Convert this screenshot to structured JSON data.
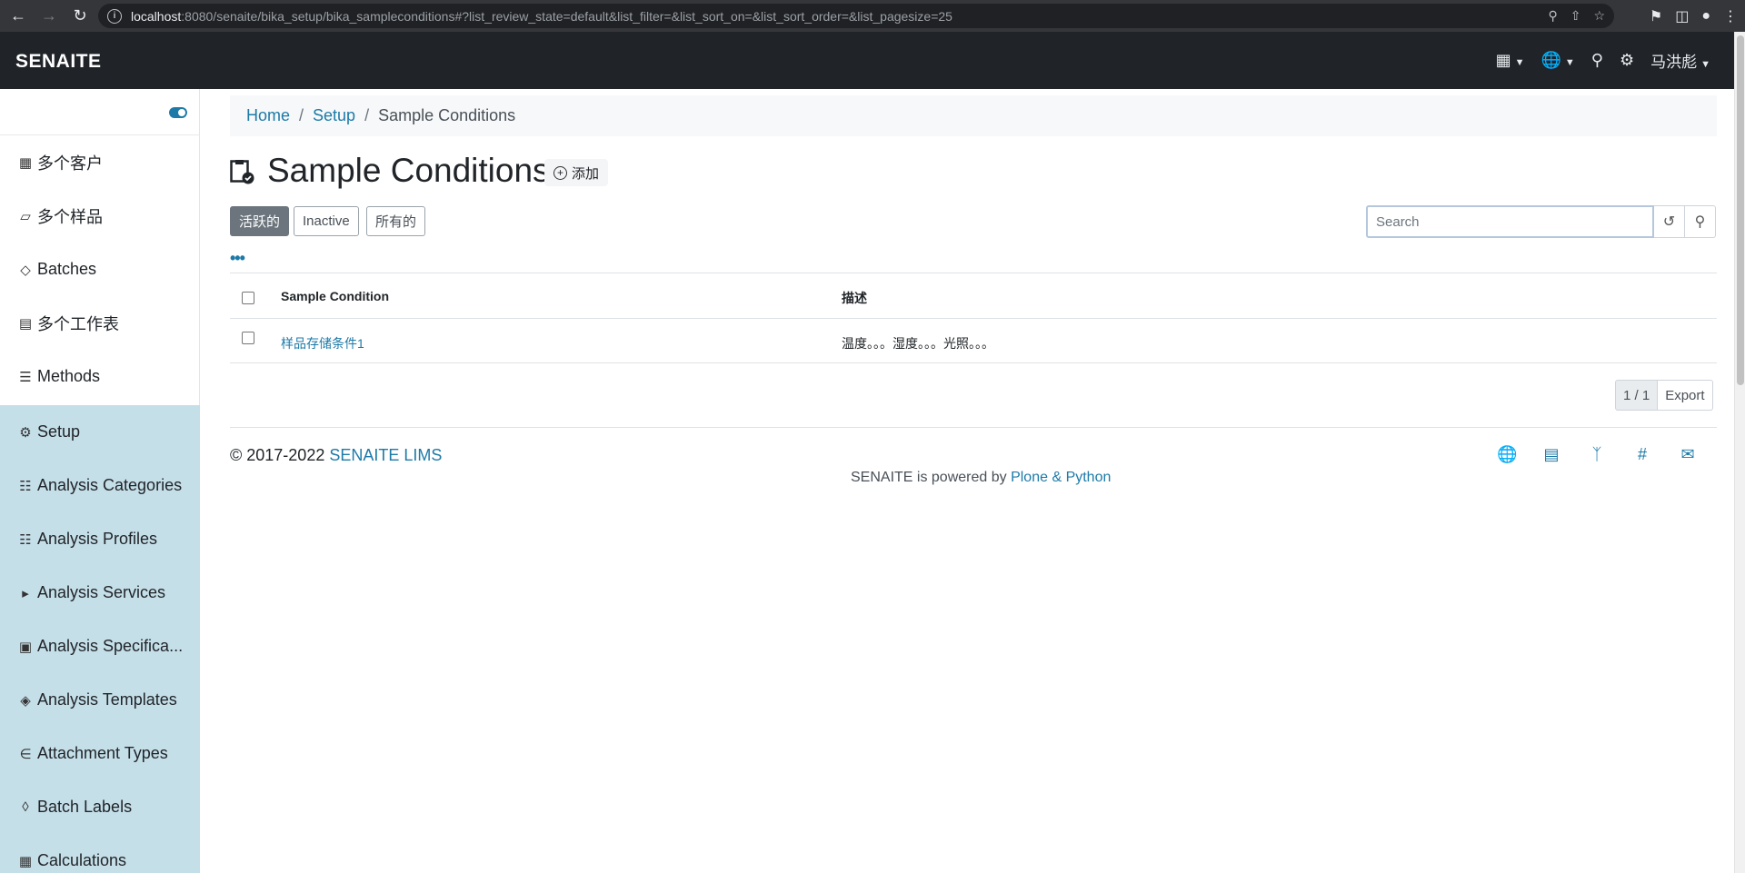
{
  "browser": {
    "url_host": "localhost",
    "url_rest": ":8080/senaite/bika_setup/bika_sampleconditions#?list_review_state=default&list_filter=&list_sort_on=&list_sort_order=&list_pagesize=25"
  },
  "header": {
    "logo": "SENAITE",
    "user_name": "马洪彪"
  },
  "sidebar": {
    "items": [
      {
        "label": "多个客户",
        "icon": "building-icon"
      },
      {
        "label": "多个样品",
        "icon": "flask-icon"
      },
      {
        "label": "Batches",
        "icon": "layers-icon"
      },
      {
        "label": "多个工作表",
        "icon": "clipboard-icon"
      },
      {
        "label": "Methods",
        "icon": "list-icon"
      },
      {
        "label": "Setup",
        "icon": "gears-icon"
      },
      {
        "label": "Analysis Categories",
        "icon": "sitemap-icon"
      },
      {
        "label": "Analysis Profiles",
        "icon": "sitemap-icon"
      },
      {
        "label": "Analysis Services",
        "icon": "bullhorn-icon"
      },
      {
        "label": "Analysis Specifica...",
        "icon": "spec-icon"
      },
      {
        "label": "Analysis Templates",
        "icon": "cube-icon"
      },
      {
        "label": "Attachment Types",
        "icon": "paperclip-icon"
      },
      {
        "label": "Batch Labels",
        "icon": "tags-icon"
      },
      {
        "label": "Calculations",
        "icon": "calculator-icon"
      }
    ]
  },
  "breadcrumb": {
    "home": "Home",
    "setup": "Setup",
    "current": "Sample Conditions"
  },
  "page": {
    "title": "Sample Conditions",
    "add_label": "添加"
  },
  "filters": {
    "active": "活跃的",
    "inactive": "Inactive",
    "all": "所有的"
  },
  "search": {
    "placeholder": "Search"
  },
  "table": {
    "columns": [
      "Sample Condition",
      "描述"
    ],
    "rows": [
      {
        "name": "样品存储条件1",
        "description": "温度。。。湿度。。。光照。。。"
      }
    ]
  },
  "pager": {
    "count": "1 / 1",
    "export": "Export"
  },
  "footer": {
    "copyright": "© 2017-2022",
    "brand": "SENAITE LIMS",
    "powered_prefix": "SENAITE is powered by",
    "powered_link": "Plone & Python"
  },
  "colors": {
    "accent": "#1d7aa8",
    "header_bg": "#202428",
    "setup_bg": "#c5dfe9"
  }
}
